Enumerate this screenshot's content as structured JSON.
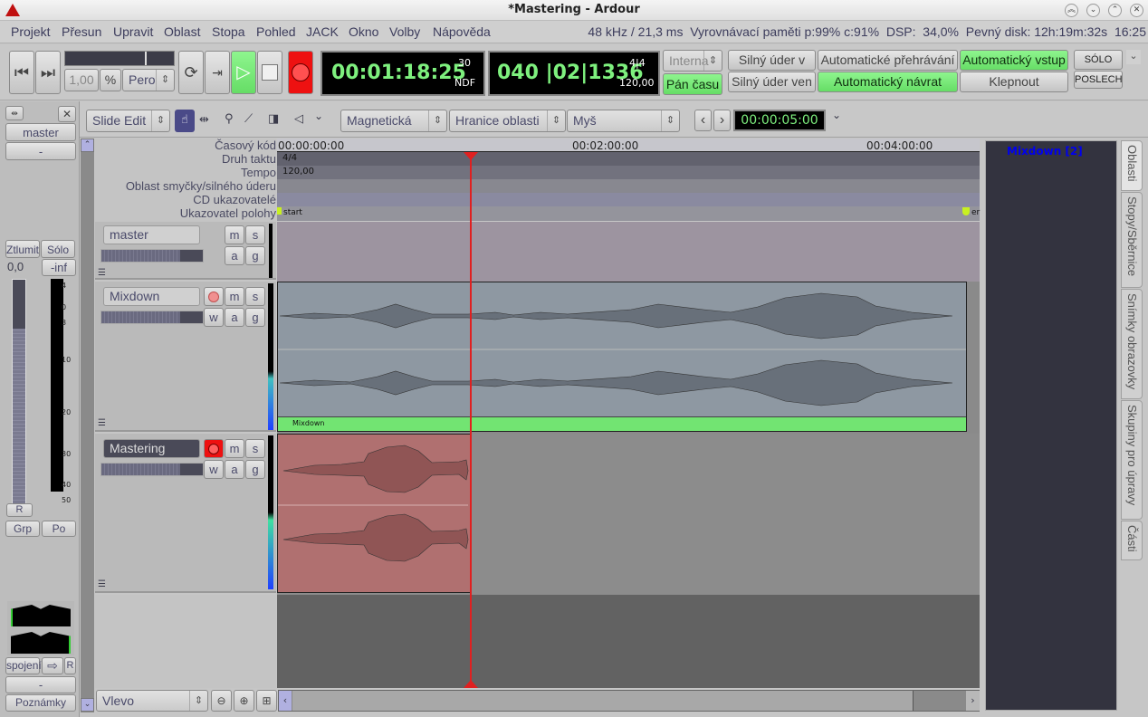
{
  "window": {
    "title": "*Mastering - Ardour",
    "controls": [
      "shade-up",
      "minimize",
      "maximize",
      "close"
    ]
  },
  "menu": [
    "Projekt",
    "Přesun",
    "Upravit",
    "Oblast",
    "Stopa",
    "Pohled",
    "JACK",
    "Okno",
    "Volby",
    "Nápověda"
  ],
  "status": {
    "text": "48 kHz / 21,3 ms  Vyrovnávací paměti p:99% c:91%  DSP:  34,0%  Pevný disk: 12h:19m:32s  16:25"
  },
  "transport": {
    "shuttle_speed": "1,00",
    "shuttle_unit": "%",
    "shuttle_mode": "Pero",
    "primary_clock": {
      "time": "00:01:18:25",
      "fps": "30",
      "mode": "NDF"
    },
    "secondary_clock": {
      "bbt": "040 |02|1336",
      "meter": "4|4",
      "tempo": "120,00"
    },
    "sync_source": "Interna",
    "time_master": "Pán času",
    "punch_in": "Silný úder v",
    "punch_out": "Silný úder ven",
    "auto_play": "Automatické přehrávání",
    "auto_input": "Automatický vstup",
    "auto_return": "Automatický návrat",
    "click": "Klepnout",
    "solo": "SÓLO",
    "listen": "POSLECH"
  },
  "toolbar": {
    "edit_mode": "Slide Edit",
    "snap_mode": "Magnetická",
    "snap_type": "Hranice oblasti",
    "edit_point": "Myš",
    "nudge_clock": "00:00:05:00",
    "zoom_focus": "Vlevo"
  },
  "editor_mixer": {
    "strip_name": "master",
    "input_button": "-",
    "mute": "Ztlumit",
    "solo": "Sólo",
    "gain": "0,0",
    "peak": "-inf",
    "meter_scale": [
      "4",
      "0",
      "3",
      "10",
      "20",
      "30",
      "40",
      "50"
    ],
    "r_button": "R",
    "group": "Grp",
    "post": "Po",
    "connections": "spojení",
    "r2_button": "R",
    "output_button": "-",
    "comments": "Poznámky"
  },
  "rulers": {
    "labels": [
      "Časový kód",
      "Druh taktu",
      "Tempo",
      "Oblast smyčky/silného úderu",
      "CD ukazovatelé",
      "Ukazovatel polohy"
    ],
    "timecode_ticks": [
      "00:00:00:00",
      "00:02:00:00",
      "00:04:00:00"
    ],
    "meter_value": "4/4",
    "tempo_value": "120,00",
    "marker_start": "start",
    "marker_end": "er"
  },
  "tracks": [
    {
      "name": "master",
      "buttons": [
        "m",
        "s",
        "a",
        "g"
      ],
      "rec": false
    },
    {
      "name": "Mixdown",
      "buttons": [
        "m",
        "s",
        "w",
        "a",
        "g"
      ],
      "rec": false,
      "region_name": "Mixdown"
    },
    {
      "name": "Mastering",
      "buttons": [
        "m",
        "s",
        "w",
        "a",
        "g"
      ],
      "rec": true
    }
  ],
  "sidebar": {
    "region_list_item": "Mixdown [2]",
    "tabs": [
      "Oblasti",
      "Stopy/Sběrnice",
      "Snímky obrazovky",
      "Skupiny pro úpravy",
      "Části"
    ]
  },
  "colors": {
    "clock_green": "#7ef07e",
    "record_red": "#ee1111",
    "region_green": "#72e472",
    "playhead": "#e02020",
    "mastering_region": "#b07070",
    "region_list_text": "#0000ee"
  }
}
